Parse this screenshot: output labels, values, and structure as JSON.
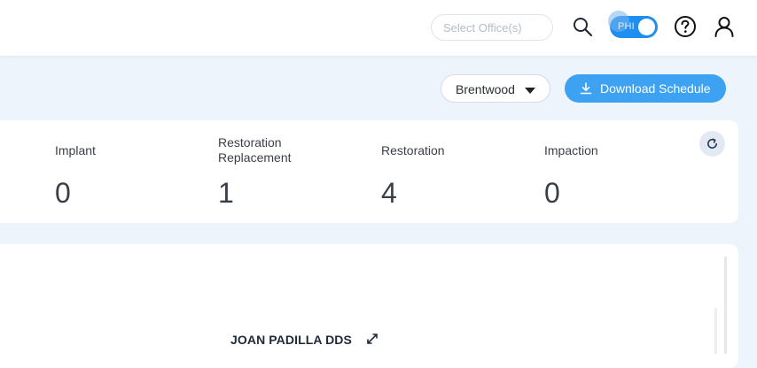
{
  "topbar": {
    "office_select": {
      "placeholder": "Select Office(s)",
      "value": ""
    },
    "phi_toggle": {
      "label": "PHI",
      "state": "on"
    },
    "icons": [
      "search-icon",
      "help-icon",
      "user-icon"
    ]
  },
  "toolbar": {
    "office_dropdown": {
      "selected": "Brentwood"
    },
    "download_label": "Download Schedule"
  },
  "stats": [
    {
      "label": "Implant",
      "value": "0"
    },
    {
      "label_lines": [
        "Restoration",
        "Replacement"
      ],
      "value": "1"
    },
    {
      "label": "Restoration",
      "value": "4"
    },
    {
      "label": "Impaction",
      "value": "0"
    }
  ],
  "schedule": {
    "provider_name": "JOAN PADILLA DDS"
  },
  "colors": {
    "accent": "#3ea2f2",
    "toggle": "#1f8ef1",
    "page_bg": "#eef4fb"
  }
}
